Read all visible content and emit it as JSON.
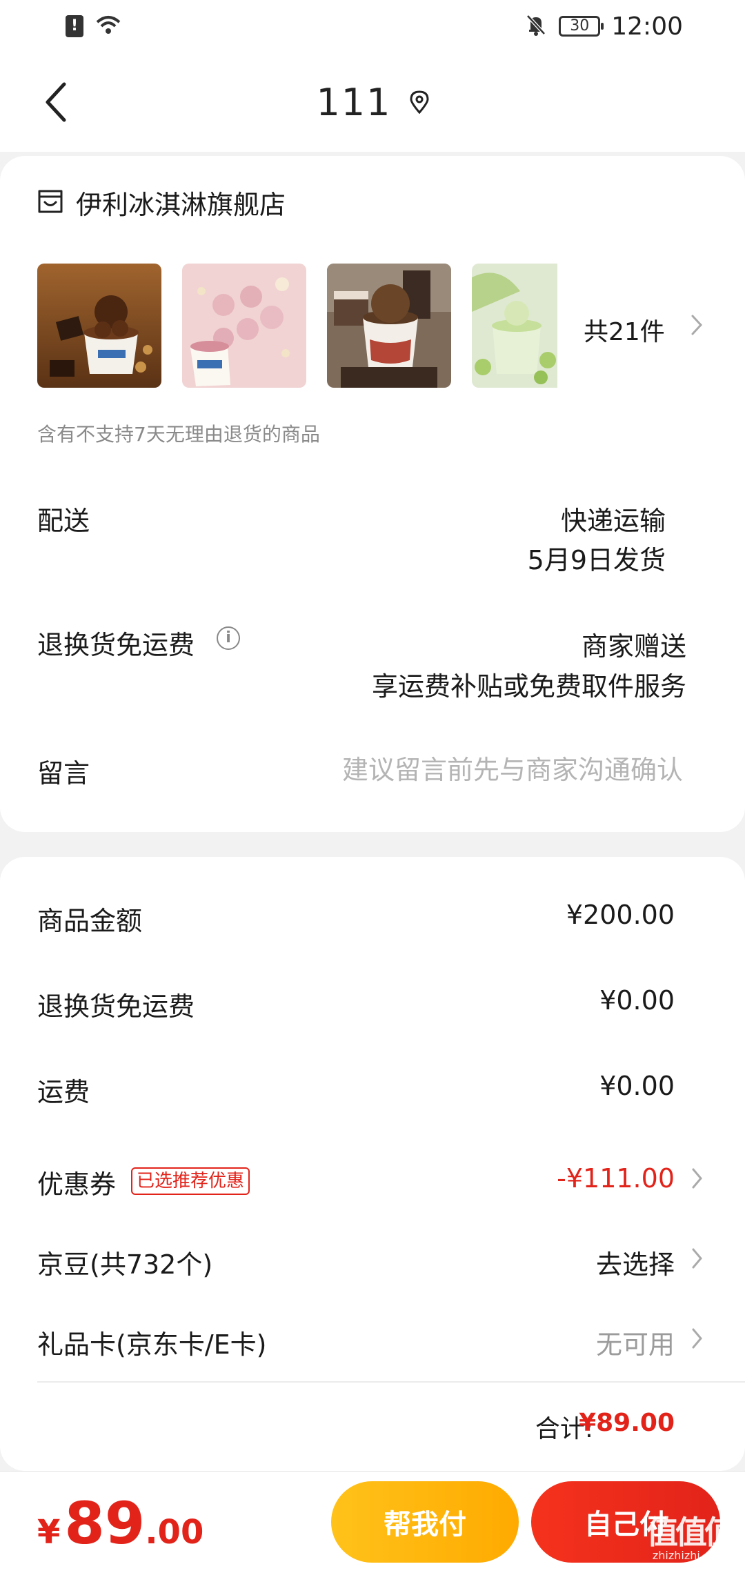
{
  "status_bar": {
    "time": "12:00",
    "battery": "30",
    "sim_icon": "sim-alert-icon",
    "wifi_icon": "wifi-icon",
    "mute_icon": "bell-off-icon"
  },
  "nav": {
    "title": "111",
    "back_icon": "chevron-left-icon",
    "location_icon": "location-pin-icon"
  },
  "store": {
    "icon": "store-icon",
    "name": "伊利冰淇淋旗舰店",
    "thumbnails": [
      "chocolate-hazelnut-ice-cream",
      "pink-ice-cream-balls",
      "chocolate-ice-cream-cup-cake",
      "melon-ice-cream-cup"
    ],
    "total_items": "共21件",
    "notice": "含有不支持7天无理由退货的商品"
  },
  "delivery": {
    "label": "配送",
    "method": "快递运输",
    "ship_date": "5月9日发货"
  },
  "return_shipping": {
    "label": "退换货免运费",
    "value": "商家赠送",
    "desc": "享运费补贴或免费取件服务"
  },
  "message": {
    "label": "留言",
    "placeholder": "建议留言前先与商家沟通确认"
  },
  "summary": {
    "goods_amount": {
      "label": "商品金额",
      "value": "¥200.00"
    },
    "return_fee": {
      "label": "退换货免运费",
      "value": "¥0.00"
    },
    "shipping": {
      "label": "运费",
      "value": "¥0.00"
    },
    "coupon": {
      "label": "优惠券",
      "badge": "已选推荐优惠",
      "value": "-¥111.00"
    },
    "jd_beans": {
      "label": "京豆(共732个)",
      "value": "去选择"
    },
    "gift_card": {
      "label": "礼品卡(京东卡/E卡)",
      "value": "无可用"
    },
    "total": {
      "label": "合计:",
      "value": "¥89.00"
    }
  },
  "bottom": {
    "price_yen": "¥",
    "price_int": "89",
    "price_dec": ".00",
    "help_pay_label": "帮我付",
    "self_pay_label": "自己付"
  },
  "watermark": {
    "line1": "值值值",
    "line2": "zhizhizhi.com"
  },
  "colors": {
    "accent_red": "#e2231a",
    "help_yellow": "#ffb60f"
  }
}
